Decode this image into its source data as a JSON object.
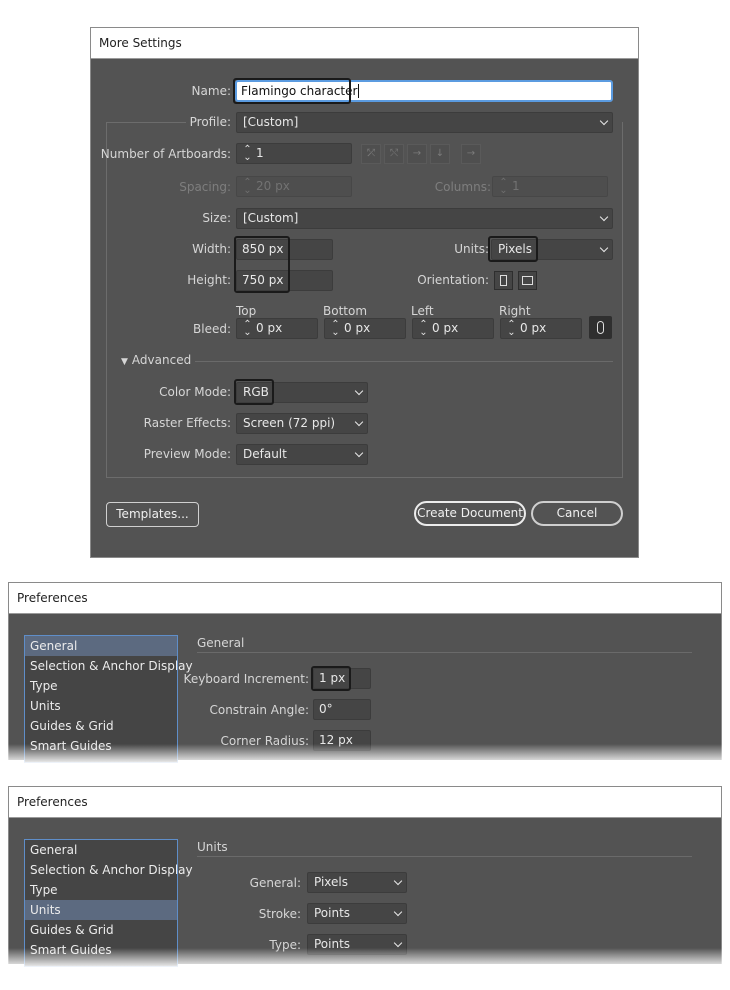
{
  "new_doc": {
    "title": "More Settings",
    "name_label": "Name:",
    "name_value": "Flamingo character",
    "profile_label": "Profile:",
    "profile_value": "[Custom]",
    "artboards_label": "Number of Artboards:",
    "artboards_value": "1",
    "spacing_label": "Spacing:",
    "spacing_value": "20 px",
    "columns_label": "Columns:",
    "columns_value": "1",
    "size_label": "Size:",
    "size_value": "[Custom]",
    "width_label": "Width:",
    "width_value": "850 px",
    "height_label": "Height:",
    "height_value": "750 px",
    "units_label": "Units:",
    "units_value": "Pixels",
    "orientation_label": "Orientation:",
    "bleed_label": "Bleed:",
    "bleed_top_label": "Top",
    "bleed_bottom_label": "Bottom",
    "bleed_left_label": "Left",
    "bleed_right_label": "Right",
    "bleed_top": "0 px",
    "bleed_bottom": "0 px",
    "bleed_left": "0 px",
    "bleed_right": "0 px",
    "advanced_label": "Advanced",
    "color_mode_label": "Color Mode:",
    "color_mode_value": "RGB",
    "raster_label": "Raster Effects:",
    "raster_value": "Screen (72 ppi)",
    "preview_label": "Preview Mode:",
    "preview_value": "Default",
    "templates_btn": "Templates...",
    "create_btn": "Create Document",
    "cancel_btn": "Cancel"
  },
  "prefs_general": {
    "title": "Preferences",
    "categories": [
      "General",
      "Selection & Anchor Display",
      "Type",
      "Units",
      "Guides & Grid",
      "Smart Guides"
    ],
    "section_title": "General",
    "keyboard_label": "Keyboard Increment:",
    "keyboard_value": "1 px",
    "constrain_label": "Constrain Angle:",
    "constrain_value": "0°",
    "corner_label": "Corner Radius:",
    "corner_value": "12 px"
  },
  "prefs_units": {
    "title": "Preferences",
    "categories": [
      "General",
      "Selection & Anchor Display",
      "Type",
      "Units",
      "Guides & Grid",
      "Smart Guides"
    ],
    "section_title": "Units",
    "general_label": "General:",
    "general_value": "Pixels",
    "stroke_label": "Stroke:",
    "stroke_value": "Points",
    "type_label": "Type:",
    "type_value": "Points"
  },
  "colors": {
    "panel_bg": "#535353",
    "field_bg": "#454545",
    "highlight_border": "#1a1a1a",
    "list_selected": "#5c6a80"
  }
}
